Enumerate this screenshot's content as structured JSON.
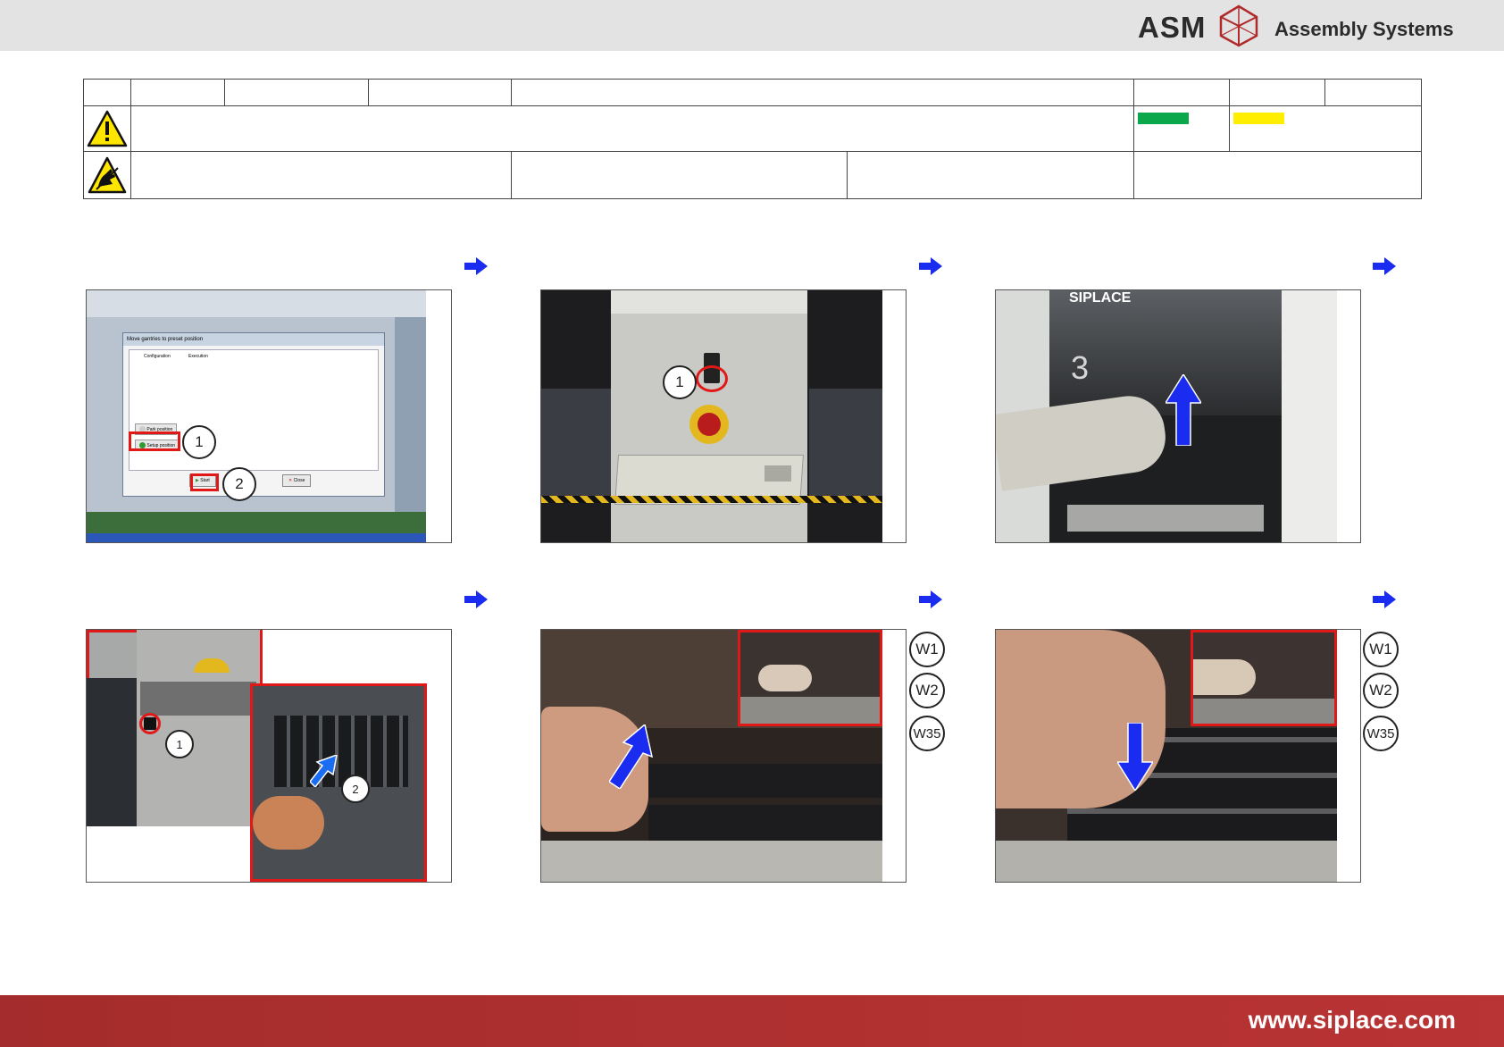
{
  "header": {
    "brand": "ASM",
    "brand_subtitle": "Assembly Systems"
  },
  "panels": {
    "p1": {
      "dialog_title": "Move gantries to preset position",
      "tab_configuration": "Configuration",
      "tab_execution": "Execution",
      "option_park": "Park position",
      "option_setup": "Setup position",
      "button_start": "Start",
      "button_close": "Close",
      "callout_1": "1",
      "callout_2": "2"
    },
    "p2": {
      "callout_1": "1"
    },
    "p3": {
      "machine_brand": "SIPLACE",
      "hood_number": "3"
    },
    "p4": {
      "callout_1": "1",
      "callout_2": "2"
    }
  },
  "tool_badges": [
    "W1",
    "W2",
    "W35"
  ],
  "colors": {
    "green_bar": "#0aa84a",
    "yellow_bar": "#ffee00",
    "arrow_blue": "#1a2cf0",
    "highlight_red": "#e01818"
  },
  "icons": [
    "warning-triangle-icon",
    "esd-warning-icon",
    "next-step-arrow-icon"
  ],
  "footer": {
    "url": "www.siplace.com"
  }
}
